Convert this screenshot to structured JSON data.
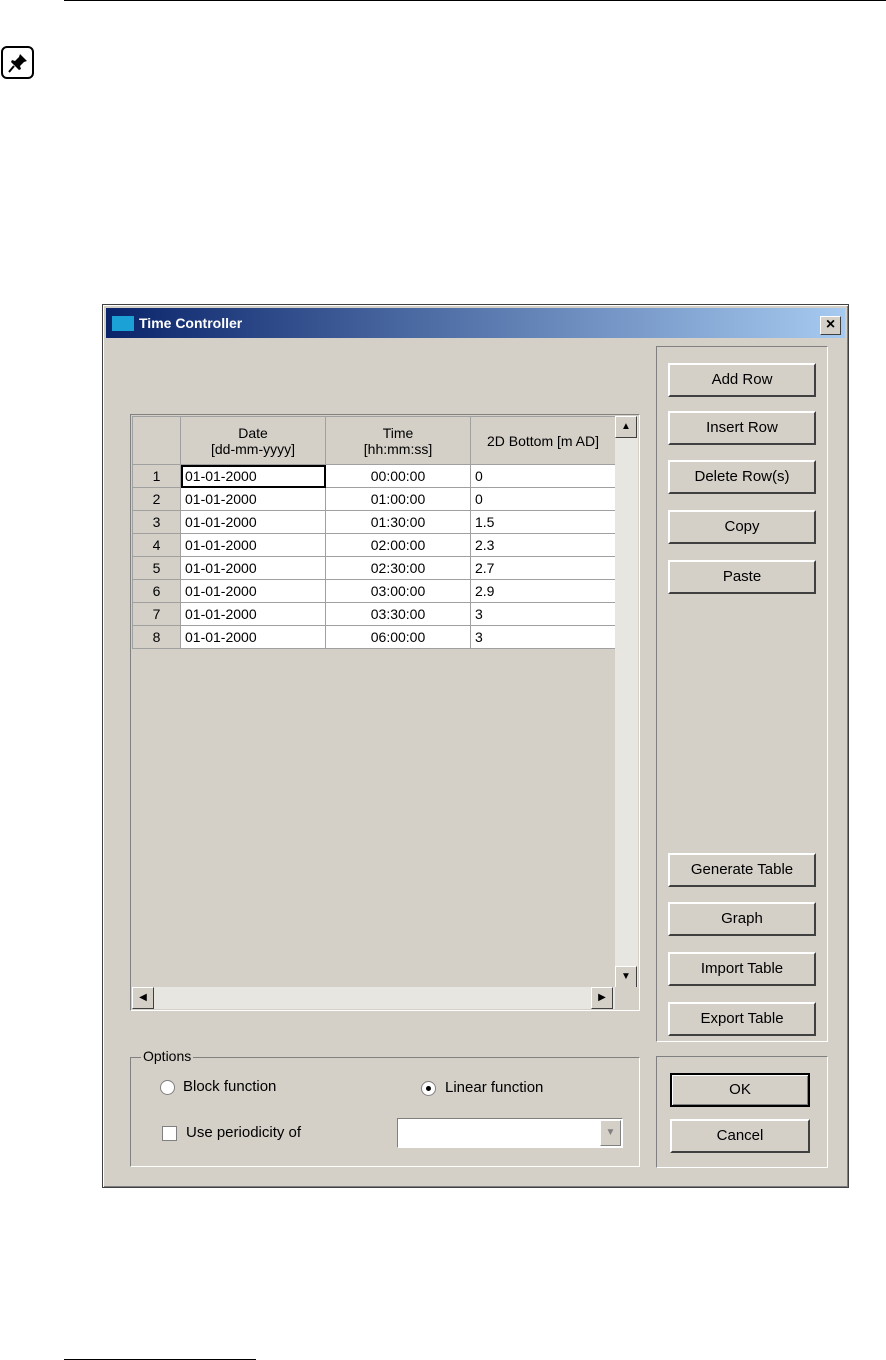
{
  "window": {
    "title": "Time Controller"
  },
  "table": {
    "headers": [
      {
        "line1": "Date",
        "line2": "[dd-mm-yyyy]"
      },
      {
        "line1": "Time",
        "line2": "[hh:mm:ss]"
      },
      {
        "line1": "2D Bottom [m AD]",
        "line2": ""
      }
    ],
    "rows": [
      {
        "num": "1",
        "date": "01-01-2000",
        "time": "00:00:00",
        "value": "0"
      },
      {
        "num": "2",
        "date": "01-01-2000",
        "time": "01:00:00",
        "value": "0"
      },
      {
        "num": "3",
        "date": "01-01-2000",
        "time": "01:30:00",
        "value": "1.5"
      },
      {
        "num": "4",
        "date": "01-01-2000",
        "time": "02:00:00",
        "value": "2.3"
      },
      {
        "num": "5",
        "date": "01-01-2000",
        "time": "02:30:00",
        "value": "2.7"
      },
      {
        "num": "6",
        "date": "01-01-2000",
        "time": "03:00:00",
        "value": "2.9"
      },
      {
        "num": "7",
        "date": "01-01-2000",
        "time": "03:30:00",
        "value": "3"
      },
      {
        "num": "8",
        "date": "01-01-2000",
        "time": "06:00:00",
        "value": "3"
      }
    ]
  },
  "buttons": {
    "add_row": "Add Row",
    "insert_row": "Insert Row",
    "delete_rows": "Delete Row(s)",
    "copy": "Copy",
    "paste": "Paste",
    "generate_table": "Generate Table",
    "graph": "Graph",
    "import_table": "Import Table",
    "export_table": "Export Table",
    "ok": "OK",
    "cancel": "Cancel"
  },
  "options": {
    "legend": "Options",
    "block_function": "Block function",
    "linear_function": "Linear function",
    "selected": "linear",
    "use_periodicity": "Use periodicity of",
    "periodicity_checked": false,
    "periodicity_value": ""
  }
}
